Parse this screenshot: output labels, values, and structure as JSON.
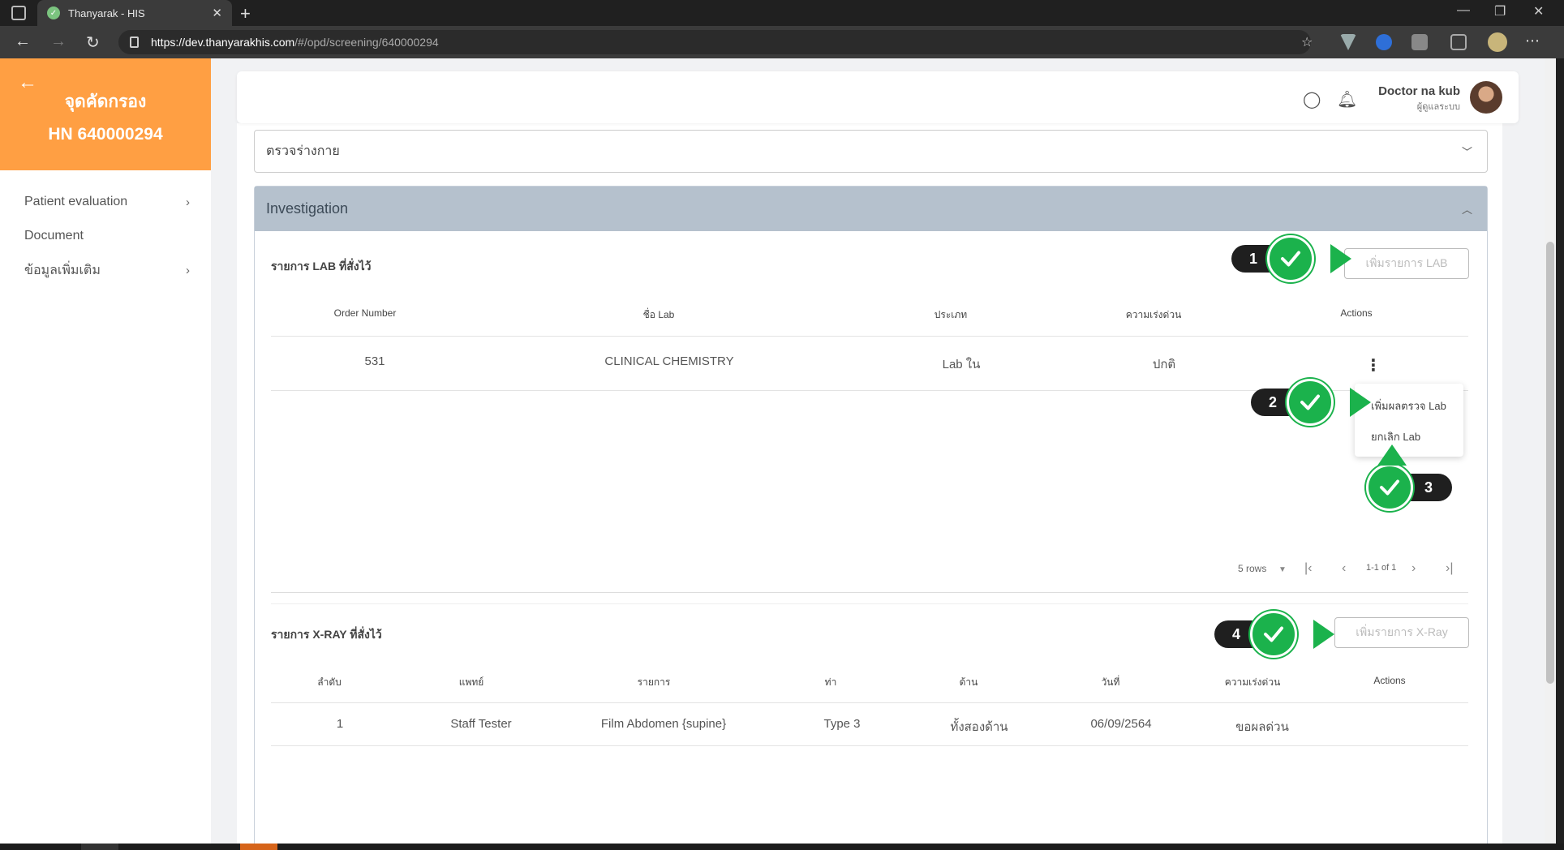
{
  "browser": {
    "tab_title": "Thanyarak - HIS",
    "url_host": "https://dev.thanyarakhis.com",
    "url_path": "/#/opd/screening/640000294"
  },
  "sidebar": {
    "title": "จุดคัดกรอง",
    "hn": "HN 640000294",
    "items": [
      {
        "label": "Patient evaluation"
      },
      {
        "label": "Document"
      },
      {
        "label": "ข้อมูลเพิ่มเติม"
      }
    ]
  },
  "header": {
    "user_name": "Doctor na kub",
    "user_role": "ผู้ดูแลระบบ"
  },
  "sections": {
    "physical_exam": "ตรวจร่างกาย",
    "investigation": "Investigation"
  },
  "lab": {
    "title": "รายการ LAB ที่สั่งไว้",
    "add_button": "เพิ่มรายการ LAB",
    "columns": [
      "Order Number",
      "ชื่อ Lab",
      "ประเภท",
      "ความเร่งด่วน",
      "Actions"
    ],
    "rows": [
      {
        "order": "531",
        "name": "CLINICAL CHEMISTRY",
        "type": "Lab ใน",
        "urgency": "ปกติ"
      }
    ],
    "menu": [
      "เพิ่มผลตรวจ Lab",
      "ยกเลิก Lab"
    ],
    "pager": {
      "rows": "5 rows",
      "range": "1-1 of 1"
    }
  },
  "xray": {
    "title": "รายการ X-RAY ที่สั่งไว้",
    "add_button": "เพิ่มรายการ X-Ray",
    "columns": [
      "ลำดับ",
      "แพทย์",
      "รายการ",
      "ท่า",
      "ด้าน",
      "วันที่",
      "ความเร่งด่วน",
      "Actions"
    ],
    "rows": [
      {
        "no": "1",
        "doctor": "Staff Tester",
        "item": "Film Abdomen {supine}",
        "pose": "Type 3",
        "side": "ทั้งสองด้าน",
        "date": "06/09/2564",
        "urgency": "ขอผลด่วน"
      }
    ]
  },
  "markers": [
    "1",
    "2",
    "3",
    "4"
  ],
  "colors": {
    "accent": "#ff9f43",
    "marker": "#1bb24c",
    "panel_header": "#b5c1cd"
  }
}
